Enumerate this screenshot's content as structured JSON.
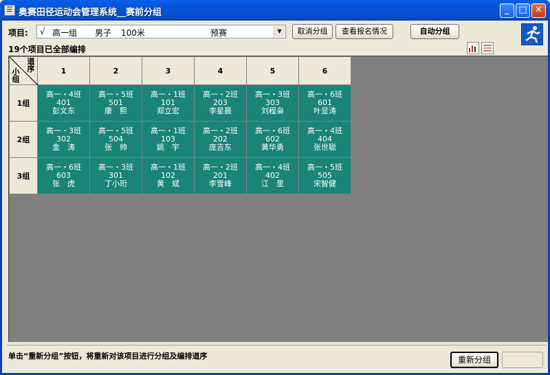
{
  "window": {
    "title": "奥赛田径运动会管理系统__赛前分组",
    "icon": "app-icon",
    "min": "_",
    "max": "□",
    "close": "✕"
  },
  "toolbar": {
    "project_label": "项目:",
    "project": {
      "check": "√",
      "grade": "高一组",
      "gender": "男子",
      "event": "100米",
      "round": "预赛"
    },
    "cancel_button": "取消分组",
    "view_button": "查看报名情况",
    "auto_button": "自动分组"
  },
  "summary": "19个项目已全部编排",
  "grid": {
    "corner_top": "道序",
    "corner_bottom": "小组",
    "lanes": [
      "1",
      "2",
      "3",
      "4",
      "5",
      "6"
    ],
    "groups": [
      {
        "name": "1组",
        "cells": [
          {
            "cls": "高一・4班",
            "no": "401",
            "name": "彭文东"
          },
          {
            "cls": "高一・5班",
            "no": "501",
            "name": "康　熙"
          },
          {
            "cls": "高一・1班",
            "no": "101",
            "name": "郑立宏"
          },
          {
            "cls": "高一・2班",
            "no": "203",
            "name": "李星晨"
          },
          {
            "cls": "高一・3班",
            "no": "303",
            "name": "刘程枭"
          },
          {
            "cls": "高一・6班",
            "no": "601",
            "name": "叶显涛"
          }
        ]
      },
      {
        "name": "2组",
        "cells": [
          {
            "cls": "高一・3班",
            "no": "302",
            "name": "金　涛"
          },
          {
            "cls": "高一・5班",
            "no": "504",
            "name": "张　帅"
          },
          {
            "cls": "高一・1班",
            "no": "103",
            "name": "姚　宇"
          },
          {
            "cls": "高一・2班",
            "no": "202",
            "name": "庞吉东"
          },
          {
            "cls": "高一・6班",
            "no": "602",
            "name": "黄华勇"
          },
          {
            "cls": "高一・4班",
            "no": "404",
            "name": "张世聪"
          }
        ]
      },
      {
        "name": "3组",
        "cells": [
          {
            "cls": "高一・6班",
            "no": "603",
            "name": "张　虎"
          },
          {
            "cls": "高一・3班",
            "no": "301",
            "name": "丁小珩"
          },
          {
            "cls": "高一・1班",
            "no": "102",
            "name": "黄　斌"
          },
          {
            "cls": "高一・2班",
            "no": "201",
            "name": "李雪峰"
          },
          {
            "cls": "高一・4班",
            "no": "402",
            "name": "江　里"
          },
          {
            "cls": "高一・5班",
            "no": "505",
            "name": "宋智健"
          }
        ]
      }
    ]
  },
  "status": "单击“重新分组”按钮，将重新对该项目进行分组及编排道序",
  "regroup_button": "重新分组",
  "colors": {
    "cell_bg": "#1a8478",
    "title_bar": "#0a4cc8",
    "grid_bg": "#808080"
  }
}
